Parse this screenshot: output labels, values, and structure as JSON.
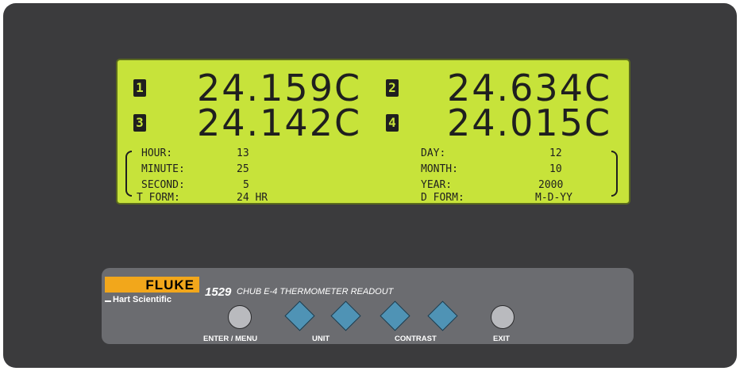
{
  "readings": [
    {
      "channel": "1",
      "value": "24.159C"
    },
    {
      "channel": "2",
      "value": "24.634C"
    },
    {
      "channel": "3",
      "value": "24.142C"
    },
    {
      "channel": "4",
      "value": "24.015C"
    }
  ],
  "time": {
    "hour_label": "HOUR:",
    "hour_value": "13",
    "minute_label": "MINUTE:",
    "minute_value": "25",
    "second_label": "SECOND:",
    "second_value": "5",
    "tform_label": "T FORM:",
    "tform_value": "24 HR"
  },
  "date": {
    "day_label": "DAY:",
    "day_value": "12",
    "month_label": "MONTH:",
    "month_value": "10",
    "year_label": "YEAR:",
    "year_value": "2000",
    "dform_label": "D FORM:",
    "dform_value": "M-D-YY"
  },
  "branding": {
    "brand": "FLUKE",
    "sub_brand": "Hart Scientific",
    "model": "1529",
    "description": "CHUB E-4 THERMOMETER READOUT"
  },
  "buttons": {
    "enter_menu_label": "ENTER / MENU",
    "unit_label": "UNIT",
    "contrast_label": "CONTRAST",
    "exit_label": "EXIT"
  },
  "colors": {
    "lcd_background": "#c7e33a",
    "device_body": "#3b3b3d",
    "panel": "#6b6c70",
    "brand_orange": "#f2a71b",
    "arrow_button": "#4f93b5",
    "round_button": "#b9babe"
  }
}
